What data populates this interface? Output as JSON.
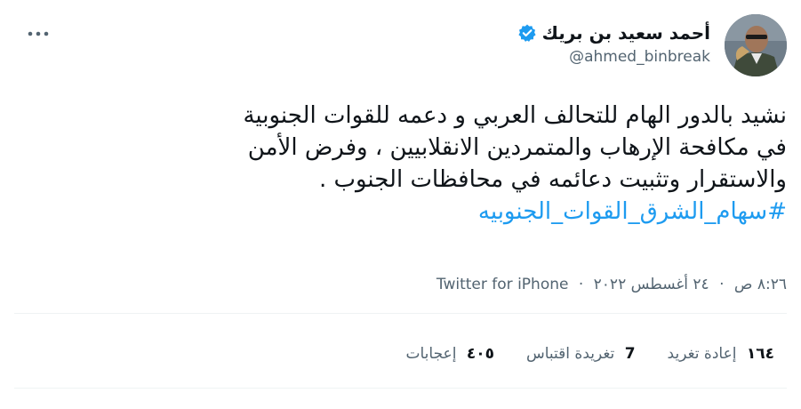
{
  "author": {
    "display_name": "أحمد سعيد بن بريك",
    "handle": "@ahmed_binbreak",
    "verified": true
  },
  "tweet": {
    "line1": "نشيد بالدور الهام للتحالف العربي و دعمه  للقوات الجنوبية",
    "line2": "في مكافحة الإرهاب والمتمردين الانقلابيين ، وفرض الأمن",
    "line3": "والاستقرار وتثبيت دعائمه في محافظات الجنوب .",
    "hashtag": "#سهام_الشرق_القوات_الجنوبيه"
  },
  "meta": {
    "time": "٨:٢٦ ص",
    "date": "٢٤ أغسطس ٢٠٢٢",
    "separator": "·",
    "source": "Twitter for iPhone"
  },
  "stats": {
    "retweets_count": "١٦٤",
    "retweets_label": "إعادة تغريد",
    "quotes_count": "7",
    "quotes_label": "تغريدة اقتباس",
    "likes_count": "٤٠٥",
    "likes_label": "إعجابات"
  },
  "colors": {
    "accent": "#1d9bf0",
    "text": "#0f1419",
    "secondary": "#536471"
  },
  "icons": {
    "verified": "verified-badge-icon",
    "more": "more-dots-icon"
  }
}
